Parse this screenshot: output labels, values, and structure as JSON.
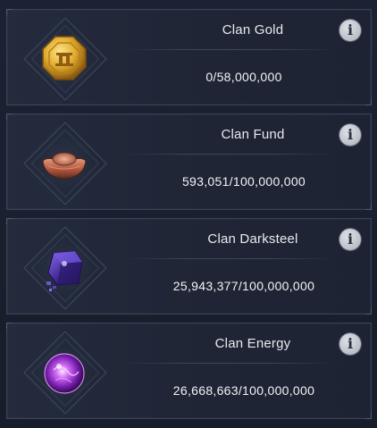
{
  "resources": [
    {
      "name": "Clan Gold",
      "value": "0/58,000,000",
      "icon": "gold-coin-icon",
      "info_glyph": "i"
    },
    {
      "name": "Clan Fund",
      "value": "593,051/100,000,000",
      "icon": "copper-ingot-icon",
      "info_glyph": "i"
    },
    {
      "name": "Clan Darksteel",
      "value": "25,943,377/100,000,000",
      "icon": "darksteel-cube-icon",
      "info_glyph": "i"
    },
    {
      "name": "Clan Energy",
      "value": "26,668,663/100,000,000",
      "icon": "energy-orb-icon",
      "info_glyph": "i"
    }
  ],
  "colors": {
    "gold": "#d8a52a",
    "copper": "#b8624a",
    "darksteel": "#4a2f9a",
    "energy": "#a347e0"
  }
}
